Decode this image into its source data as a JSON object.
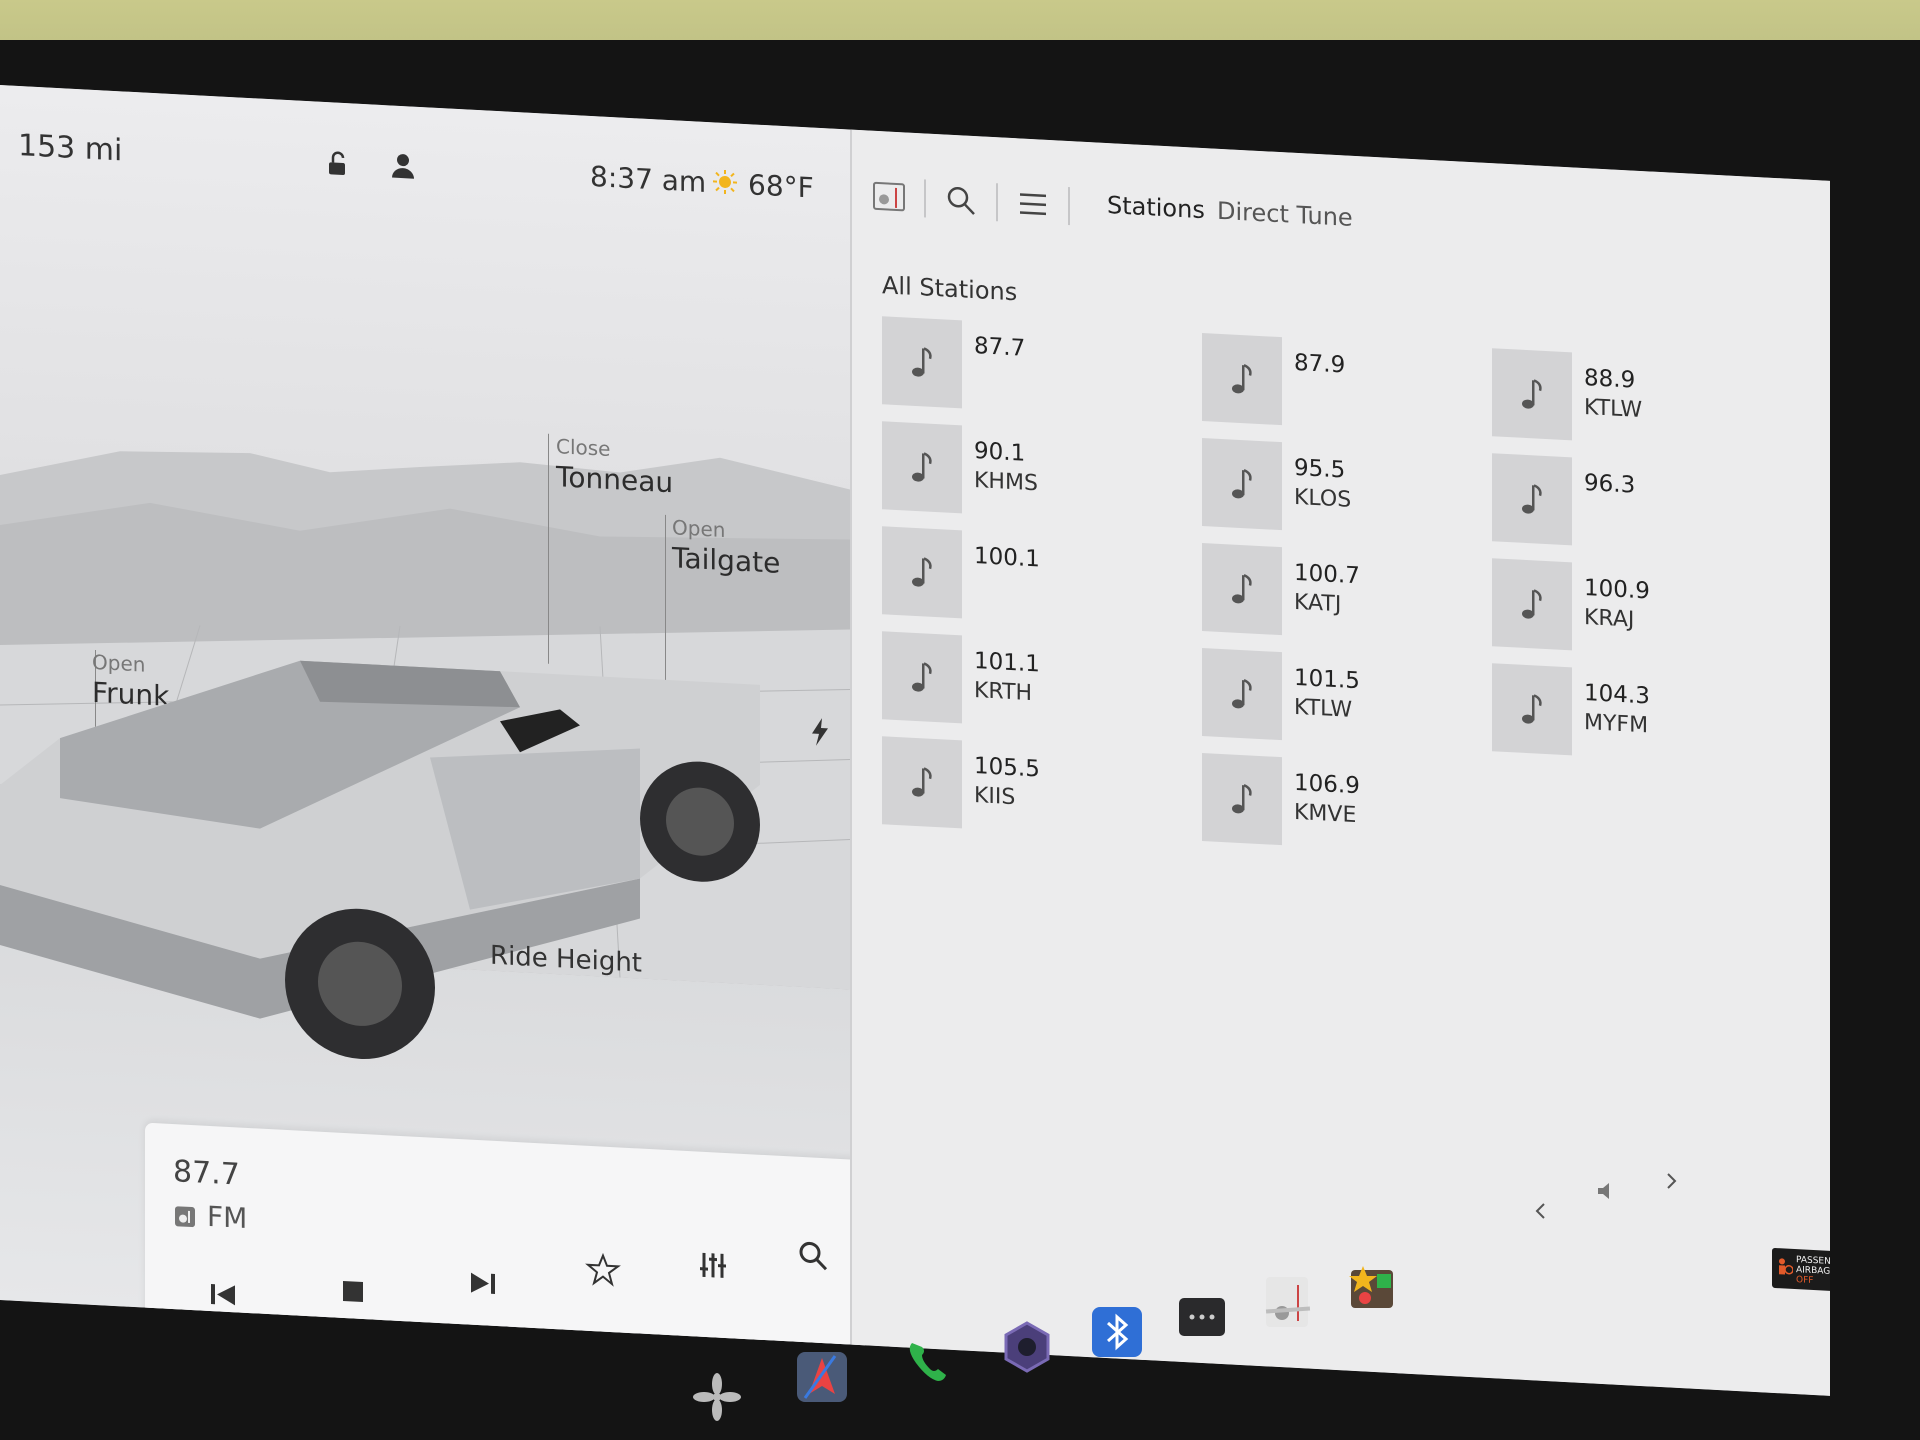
{
  "status": {
    "range": "153 mi",
    "time": "8:37 am",
    "temperature": "68°F",
    "icons": [
      "lock-open-icon",
      "driver-profile-icon",
      "sun-icon"
    ]
  },
  "vehicle_controls": {
    "frunk": {
      "action": "Open",
      "name": "Frunk"
    },
    "tonneau": {
      "action": "Close",
      "name": "Tonneau"
    },
    "tailgate": {
      "action": "Open",
      "name": "Tailgate"
    },
    "ride_height": "Ride Height",
    "charge_port_icon": "lightning-bolt-icon"
  },
  "media_player": {
    "frequency": "87.7",
    "band": "FM",
    "controls": [
      "previous-icon",
      "stop-icon",
      "next-icon",
      "favorite-star-icon",
      "equalizer-icon",
      "search-icon"
    ]
  },
  "radio": {
    "tabs": [
      "Stations",
      "Direct Tune"
    ],
    "toolbar_icons": [
      "radio-source-icon",
      "search-icon",
      "list-icon"
    ],
    "section_title": "All Stations",
    "stations": [
      {
        "freq": "87.7",
        "call": ""
      },
      {
        "freq": "90.1",
        "call": "KHMS"
      },
      {
        "freq": "100.1",
        "call": ""
      },
      {
        "freq": "101.1",
        "call": "KRTH"
      },
      {
        "freq": "105.5",
        "call": "KIIS"
      },
      {
        "freq": "87.9",
        "call": ""
      },
      {
        "freq": "95.5",
        "call": "KLOS"
      },
      {
        "freq": "100.7",
        "call": "KATJ"
      },
      {
        "freq": "101.5",
        "call": "KTLW"
      },
      {
        "freq": "106.9",
        "call": "KMVE"
      },
      {
        "freq": "88.9",
        "call": "KTLW"
      },
      {
        "freq": "96.3",
        "call": ""
      },
      {
        "freq": "100.9",
        "call": "KRAJ"
      },
      {
        "freq": "104.3",
        "call": "MYFM"
      }
    ]
  },
  "airbag": {
    "line1": "PASSENGER",
    "line2": "AIRBAG",
    "state": "OFF"
  },
  "dock": {
    "apps": [
      "fan-icon",
      "navigation-icon",
      "phone-icon",
      "dashcam-icon",
      "bluetooth-icon",
      "more-icon",
      "radio-app-icon",
      "toybox-icon"
    ],
    "volume_icon": "speaker-icon"
  },
  "colors": {
    "accent_blue": "#2f6fd6",
    "phone_green": "#2fb24a",
    "airbag_off": "#e25a2a"
  }
}
